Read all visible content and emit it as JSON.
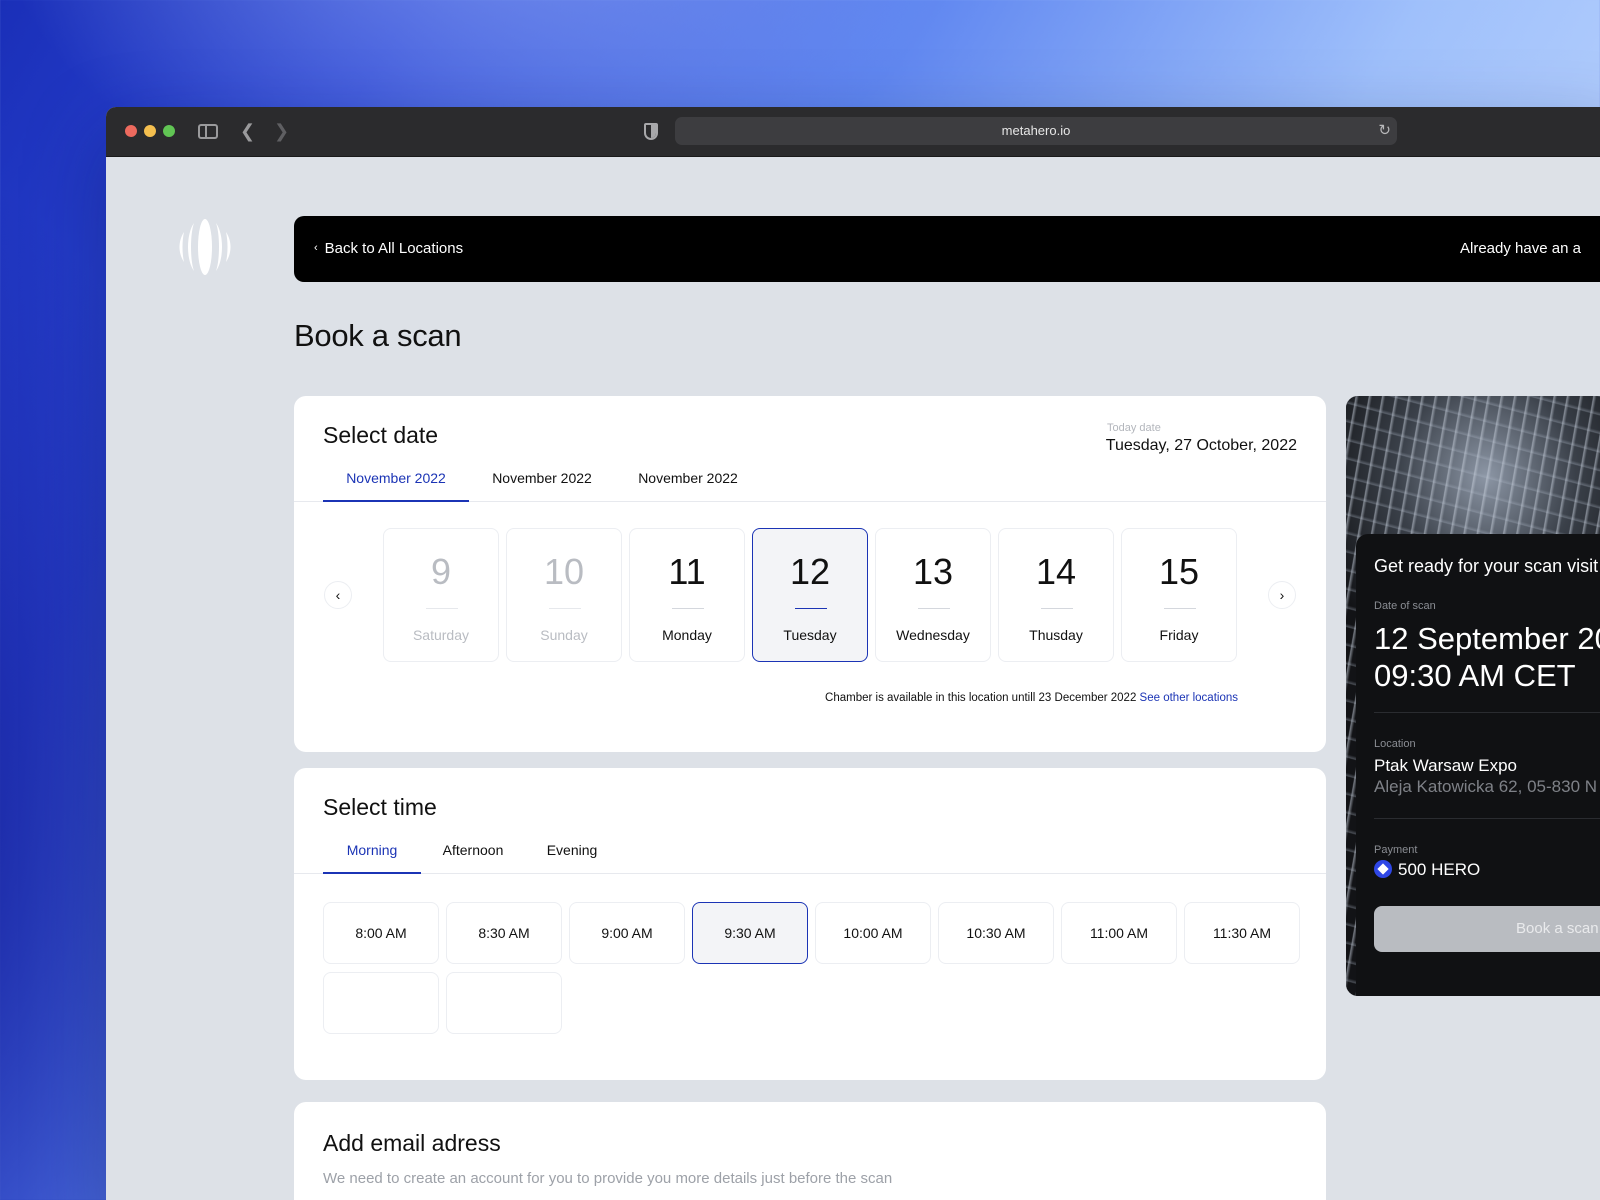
{
  "browser": {
    "url": "metahero.io"
  },
  "header": {
    "back_label": "Back to All Locations",
    "account_label": "Already have an a"
  },
  "page_title": "Book a scan",
  "select_date": {
    "title": "Select date",
    "today_label": "Today date",
    "today_value": "Tuesday, 27 October, 2022",
    "month_tabs": [
      "November 2022",
      "November 2022",
      "November 2022"
    ],
    "days": [
      {
        "num": "9",
        "label": "Saturday",
        "state": "disabled"
      },
      {
        "num": "10",
        "label": "Sunday",
        "state": "disabled"
      },
      {
        "num": "11",
        "label": "Monday",
        "state": "available"
      },
      {
        "num": "12",
        "label": "Tuesday",
        "state": "selected"
      },
      {
        "num": "13",
        "label": "Wednesday",
        "state": "available"
      },
      {
        "num": "14",
        "label": "Thusday",
        "state": "available"
      },
      {
        "num": "15",
        "label": "Friday",
        "state": "available"
      }
    ],
    "prev_icon": "‹",
    "next_icon": "›",
    "availability_text": "Chamber is available in this location untill 23 December 2022",
    "availability_link": "See other locations"
  },
  "select_time": {
    "title": "Select time",
    "tabs": [
      "Morning",
      "Afternoon",
      "Evening"
    ],
    "slots": [
      "8:00 AM",
      "8:30 AM",
      "9:00 AM",
      "9:30 AM",
      "10:00 AM",
      "10:30 AM",
      "11:00 AM",
      "11:30 AM",
      "",
      ""
    ],
    "selected_slot": "9:30 AM"
  },
  "email": {
    "title": "Add email adress",
    "subtitle": "We need to create an account for you to provide you more details just before the scan"
  },
  "summary": {
    "heading": "Get ready for your scan visit",
    "date_label": "Date of scan",
    "date_value": "12 September 20",
    "time_value": "09:30 AM CET",
    "location_label": "Location",
    "location_name": "Ptak Warsaw Expo",
    "location_address": "Aleja Katowicka 62, 05-830 N",
    "payment_label": "Payment",
    "payment_value": "500 HERO",
    "book_button": "Book a scan"
  },
  "colors": {
    "accent": "#1b34b5",
    "panel": "#101113"
  }
}
